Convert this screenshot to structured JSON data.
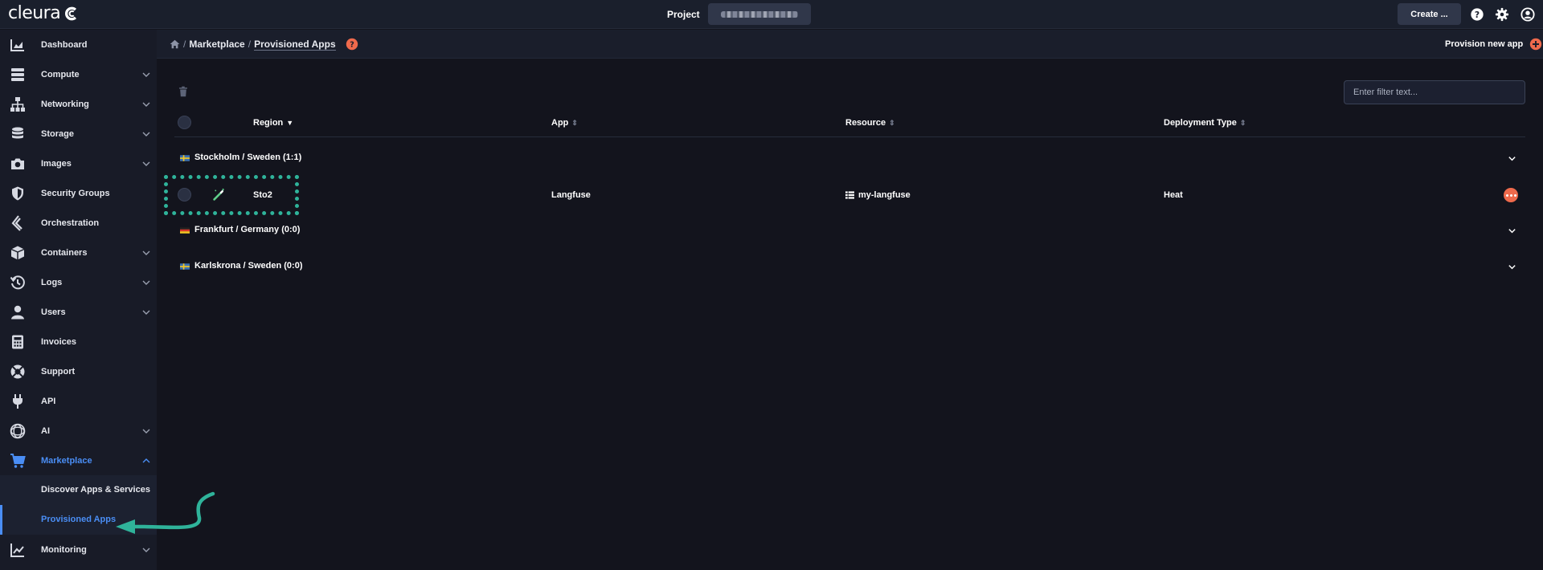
{
  "brand": {
    "name": "cleura"
  },
  "topbar": {
    "project_label": "Project",
    "project_value": "",
    "create_label": "Create ...",
    "icons": [
      "help-icon",
      "gear-icon",
      "user-icon"
    ]
  },
  "sidebar": {
    "items": [
      {
        "label": "Dashboard",
        "icon": "dashboard-icon",
        "has_chevron": false
      },
      {
        "label": "Compute",
        "icon": "compute-icon",
        "has_chevron": true
      },
      {
        "label": "Networking",
        "icon": "networking-icon",
        "has_chevron": true
      },
      {
        "label": "Storage",
        "icon": "storage-icon",
        "has_chevron": true
      },
      {
        "label": "Images",
        "icon": "camera-icon",
        "has_chevron": true
      },
      {
        "label": "Security Groups",
        "icon": "shield-icon",
        "has_chevron": false
      },
      {
        "label": "Orchestration",
        "icon": "orchestration-icon",
        "has_chevron": false
      },
      {
        "label": "Containers",
        "icon": "cube-icon",
        "has_chevron": true
      },
      {
        "label": "Logs",
        "icon": "history-icon",
        "has_chevron": true
      },
      {
        "label": "Users",
        "icon": "user-icon",
        "has_chevron": true
      },
      {
        "label": "Invoices",
        "icon": "calculator-icon",
        "has_chevron": false
      },
      {
        "label": "Support",
        "icon": "lifebuoy-icon",
        "has_chevron": false
      },
      {
        "label": "API",
        "icon": "plug-icon",
        "has_chevron": false
      },
      {
        "label": "AI",
        "icon": "ai-icon",
        "has_chevron": true
      },
      {
        "label": "Marketplace",
        "icon": "cart-icon",
        "has_chevron": true,
        "expanded": true
      },
      {
        "label": "Monitoring",
        "icon": "monitoring-icon",
        "has_chevron": true
      }
    ],
    "marketplace_sub": [
      {
        "label": "Discover Apps & Services"
      },
      {
        "label": "Provisioned Apps",
        "current": true
      }
    ],
    "accent_color": "#4a8ef5"
  },
  "breadcrumb": {
    "items": [
      "Marketplace",
      "Provisioned Apps"
    ],
    "separator": "/",
    "help_icon": "help-circle-icon"
  },
  "actions": {
    "provision_label": "Provision new app",
    "provision_icon": "plus-circle-icon",
    "accent_color": "#ef6a4c"
  },
  "filter": {
    "placeholder": "Enter filter text..."
  },
  "table": {
    "columns": [
      {
        "label": "Region",
        "sort": "desc"
      },
      {
        "label": "App",
        "sort": "none"
      },
      {
        "label": "Resource",
        "sort": "none"
      },
      {
        "label": "Deployment Type",
        "sort": "none"
      }
    ],
    "groups": [
      {
        "name": "Stockholm / Sweden (1:1)",
        "flag": "sweden-flag-icon",
        "rows": [
          {
            "region": "Sto2",
            "app": "Langfuse",
            "resource": "my-langfuse",
            "resource_icon": "table-icon",
            "deployment_type": "Heat",
            "app_icon": "wand-icon"
          }
        ]
      },
      {
        "name": "Frankfurt / Germany (0:0)",
        "flag": "germany-flag-icon",
        "rows": []
      },
      {
        "name": "Karlskrona / Sweden (0:0)",
        "flag": "sweden-flag-icon",
        "rows": []
      }
    ]
  },
  "annotation": {
    "highlight_color": "#2fb39a"
  }
}
